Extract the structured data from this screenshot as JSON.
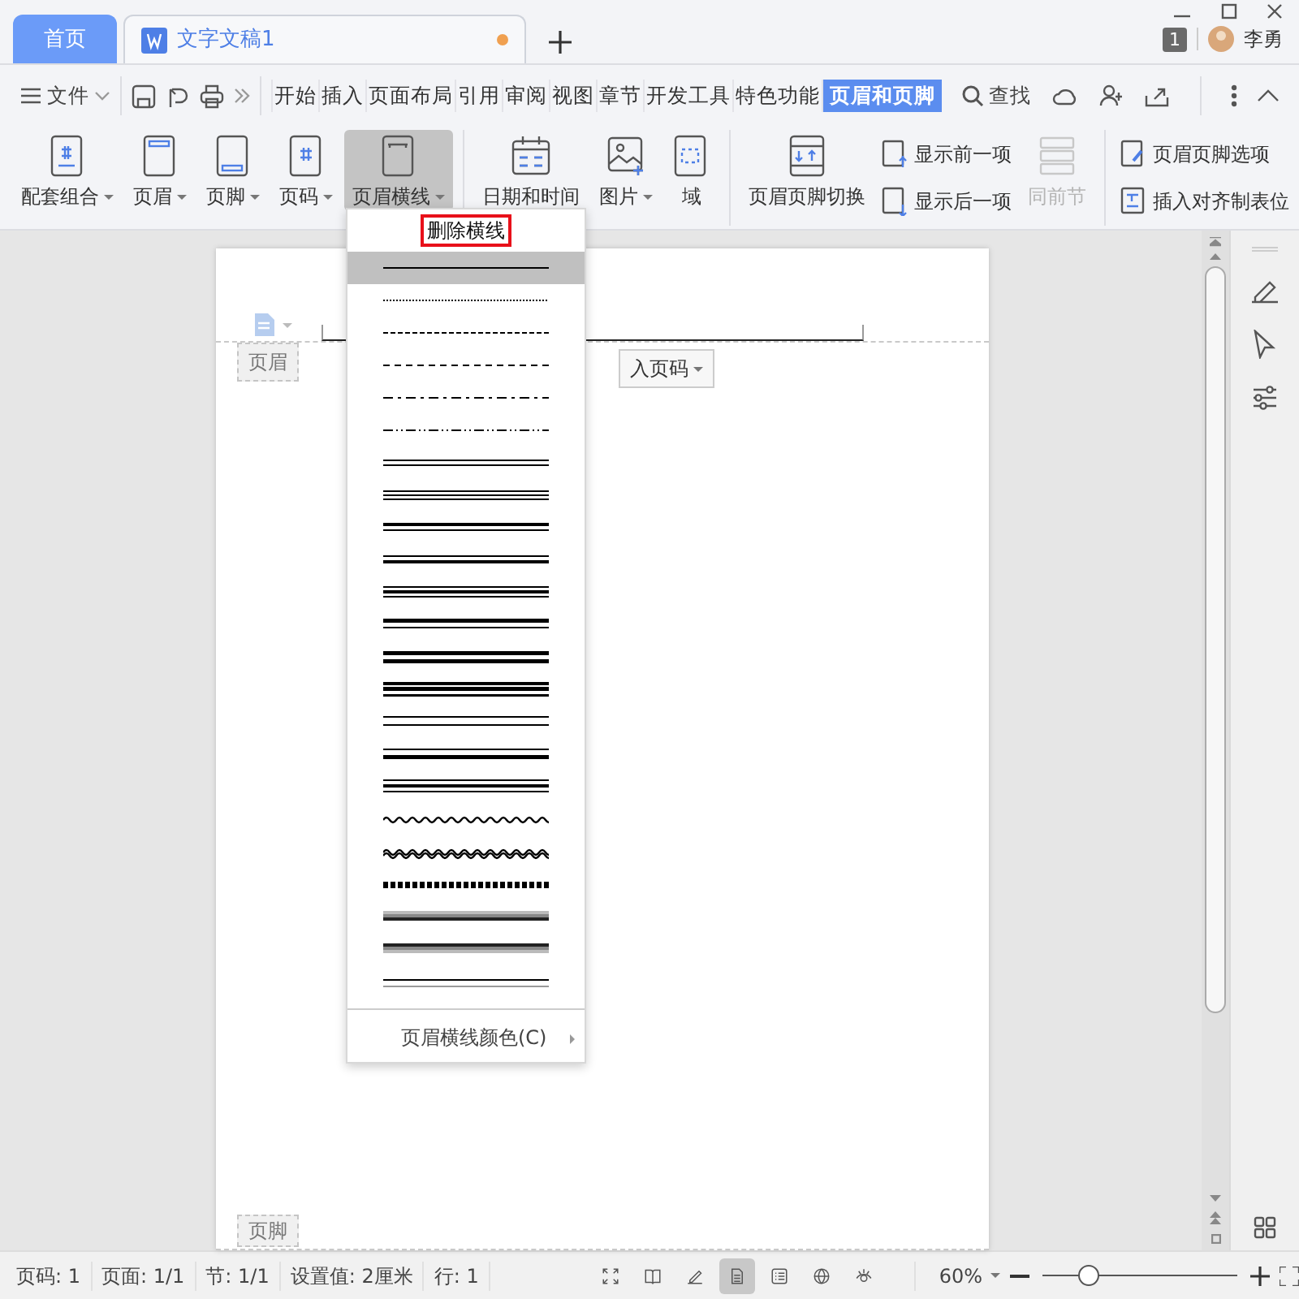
{
  "tabs": [
    {
      "label": "首页",
      "kind": "home",
      "selected": false
    },
    {
      "label": "文字文稿1",
      "kind": "document",
      "selected": true,
      "unsaved": true
    }
  ],
  "account": {
    "badge": "1",
    "user": "李勇"
  },
  "file_menu": "文件",
  "menu_tabs": [
    {
      "label": "开始",
      "selected": false
    },
    {
      "label": "插入",
      "selected": false
    },
    {
      "label": "页面布局",
      "selected": false
    },
    {
      "label": "引用",
      "selected": false
    },
    {
      "label": "审阅",
      "selected": false
    },
    {
      "label": "视图",
      "selected": false
    },
    {
      "label": "章节",
      "selected": false
    },
    {
      "label": "开发工具",
      "selected": false
    },
    {
      "label": "特色功能",
      "selected": false
    },
    {
      "label": "页眉和页脚",
      "selected": true
    }
  ],
  "search": "查找",
  "ribbon": [
    [
      {
        "label": "配套组合",
        "kind": "large",
        "dropdown": true,
        "selected": false,
        "disabled": false
      },
      {
        "label": "页眉",
        "kind": "large",
        "dropdown": true,
        "selected": false,
        "disabled": false
      },
      {
        "label": "页脚",
        "kind": "large",
        "dropdown": true,
        "selected": false,
        "disabled": false
      },
      {
        "label": "页码",
        "kind": "large",
        "dropdown": true,
        "selected": false,
        "disabled": false
      },
      {
        "label": "页眉横线",
        "kind": "large",
        "dropdown": true,
        "selected": true,
        "disabled": false
      }
    ],
    [
      {
        "label": "日期和时间",
        "kind": "large",
        "dropdown": false,
        "selected": false,
        "disabled": false
      },
      {
        "label": "图片",
        "kind": "large",
        "dropdown": true,
        "selected": false,
        "disabled": false
      },
      {
        "label": "域",
        "kind": "large",
        "dropdown": false,
        "selected": false,
        "disabled": false
      }
    ],
    [
      {
        "label": "页眉页脚切换",
        "kind": "large",
        "dropdown": false,
        "selected": false,
        "disabled": false
      },
      {
        "label": "显示前一项",
        "kind": "small",
        "dropdown": false,
        "selected": false,
        "disabled": false
      },
      {
        "label": "显示后一项",
        "kind": "small",
        "dropdown": false,
        "selected": false,
        "disabled": false
      },
      {
        "label": "同前节",
        "kind": "large",
        "dropdown": false,
        "selected": false,
        "disabled": true
      }
    ],
    [
      {
        "label": "页眉页脚选项",
        "kind": "small",
        "dropdown": false,
        "selected": false,
        "disabled": false
      },
      {
        "label": "插入对齐制表位",
        "kind": "small",
        "dropdown": false,
        "selected": false,
        "disabled": false
      }
    ]
  ],
  "line_menu": {
    "header": "删除横线",
    "footer": "页眉横线颜色(C)",
    "styles": [
      {
        "kind": "solid",
        "selected": true
      },
      {
        "kind": "dotted",
        "selected": false
      },
      {
        "kind": "dashsmall",
        "selected": false
      },
      {
        "kind": "dashed",
        "selected": false
      },
      {
        "kind": "dashdot",
        "selected": false
      },
      {
        "kind": "dashdotdot",
        "selected": false
      },
      {
        "kind": "double",
        "selected": false
      },
      {
        "kind": "triple",
        "selected": false
      },
      {
        "kind": "thickthin",
        "selected": false
      },
      {
        "kind": "thinthick",
        "selected": false
      },
      {
        "kind": "thinthickthin",
        "selected": false
      },
      {
        "kind": "heavythin",
        "selected": false
      },
      {
        "kind": "heavyheavy",
        "selected": false
      },
      {
        "kind": "heavytriple",
        "selected": false
      },
      {
        "kind": "doublewide",
        "selected": false
      },
      {
        "kind": "thinthickwide",
        "selected": false
      },
      {
        "kind": "thinthickthinwide",
        "selected": false
      },
      {
        "kind": "wave",
        "selected": false
      },
      {
        "kind": "doublewave",
        "selected": false
      },
      {
        "kind": "hatched",
        "selected": false
      },
      {
        "kind": "shadedown",
        "selected": false
      },
      {
        "kind": "shadeup",
        "selected": false
      },
      {
        "kind": "engraved",
        "selected": false
      }
    ]
  },
  "document": {
    "header_label": "页眉",
    "page_number_button": "入页码",
    "footer_label": "页脚"
  },
  "status_bar": {
    "items": [
      "页码: 1",
      "页面: 1/1",
      "节: 1/1",
      "设置值: 2厘米",
      "行: 1"
    ],
    "view_modes": [
      {
        "selected": false
      },
      {
        "selected": false
      },
      {
        "selected": false
      },
      {
        "selected": true
      },
      {
        "selected": false
      },
      {
        "selected": false
      },
      {
        "selected": false
      }
    ],
    "zoom": "60%",
    "zoom_slider": {
      "level": 0.23
    }
  }
}
